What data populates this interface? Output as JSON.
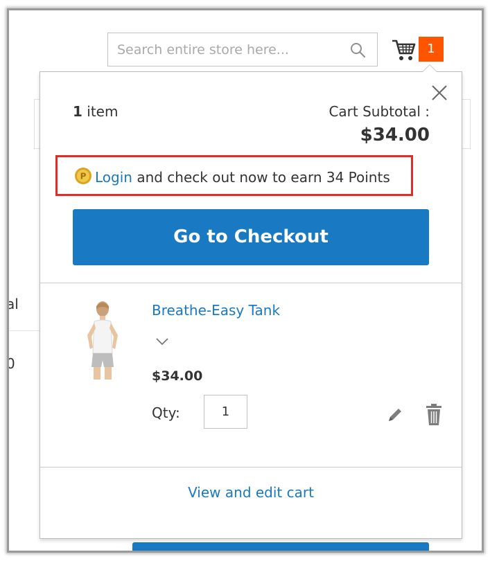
{
  "search": {
    "placeholder": "Search entire store here..."
  },
  "cart": {
    "counter": "1"
  },
  "background": {
    "text_left_1": "al",
    "text_left_2": "0"
  },
  "minicart": {
    "items_count_number": "1",
    "items_count_label": " item",
    "subtotal_label": "Cart Subtotal :",
    "subtotal_amount": "$34.00",
    "reward": {
      "link_label": "Login",
      "message": " and check out now to earn 34 Points"
    },
    "checkout_label": "Go to Checkout",
    "product": {
      "name": "Breathe-Easy Tank",
      "price": "$34.00",
      "qty_label": "Qty:",
      "qty_value": "1"
    },
    "view_cart_label": "View and edit cart"
  },
  "colors": {
    "accent": "#1979c3",
    "counter": "#ff5501",
    "highlight_border": "#e02b27"
  }
}
